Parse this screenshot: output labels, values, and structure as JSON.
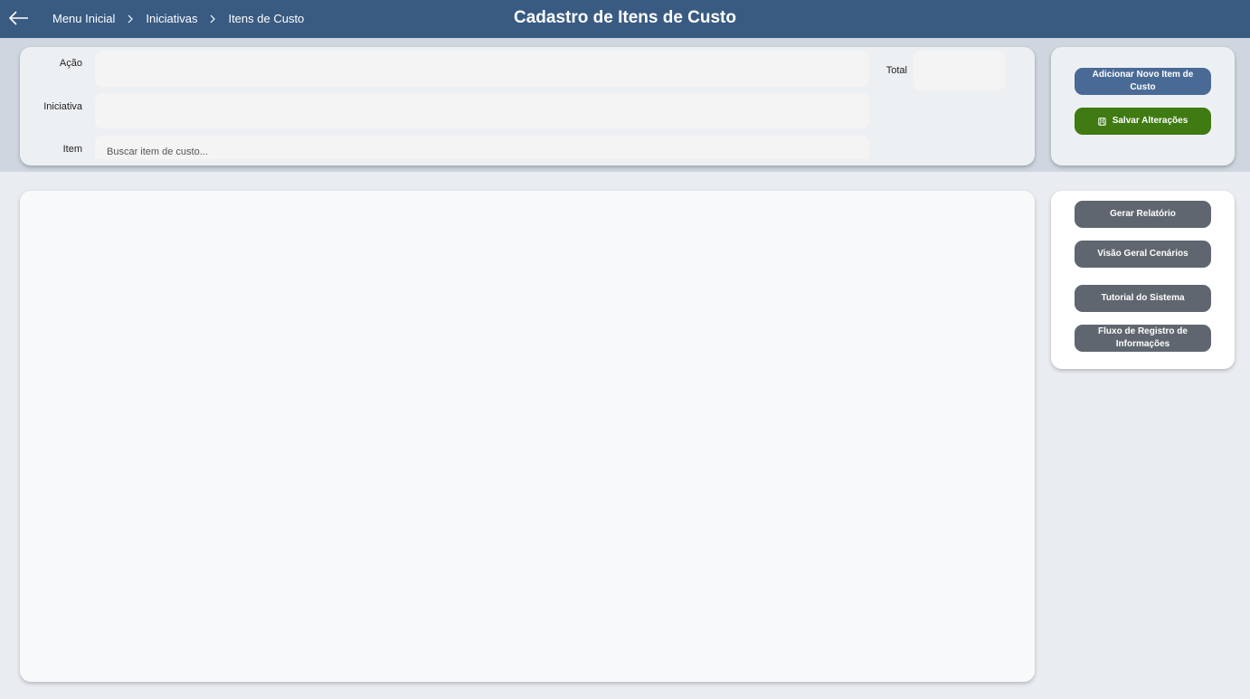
{
  "header": {
    "title": "Cadastro de Itens de Custo",
    "back_icon": "arrow-left-icon",
    "breadcrumb": [
      "Menu Inicial",
      "Iniciativas",
      "Itens de Custo"
    ]
  },
  "form": {
    "acao_label": "Ação",
    "acao_value": "",
    "iniciativa_label": "Iniciativa",
    "iniciativa_value": "",
    "item_label": "Item",
    "item_placeholder": "Buscar item de custo...",
    "total_label": "Total",
    "total_value": ""
  },
  "actions": {
    "add_label": "Adicionar Novo Item de Custo",
    "save_label": "Salvar Alterações",
    "save_icon": "save-icon"
  },
  "side_menu": {
    "items": [
      "Gerar Relatório",
      "Visão Geral Cenários",
      "Tutorial do Sistema",
      "Fluxo de Registro de Informações"
    ]
  },
  "colors": {
    "header": "#395b82",
    "add_button": "#4a6a96",
    "save_button": "#3f7a12",
    "menu_button": "#60666f"
  }
}
